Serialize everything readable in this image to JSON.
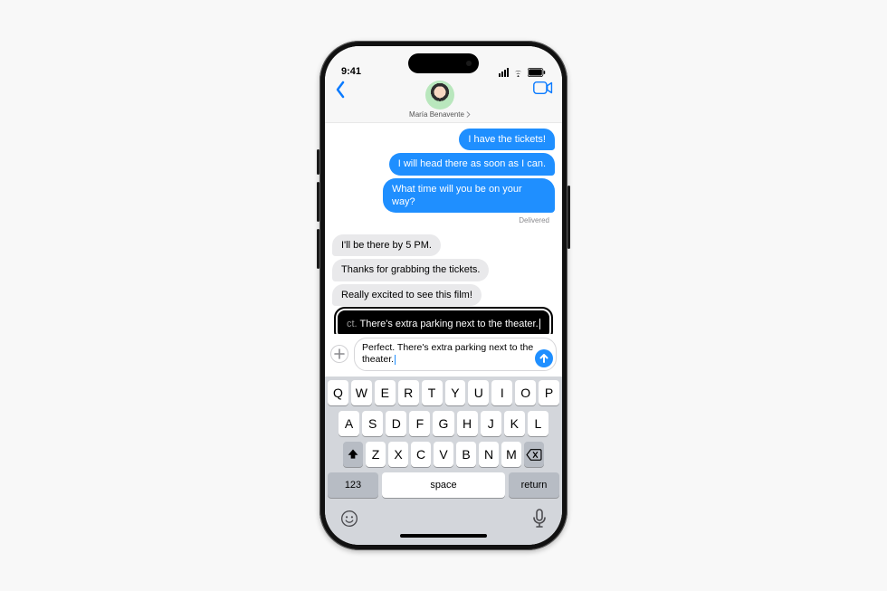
{
  "status": {
    "time": "9:41"
  },
  "contact": {
    "name": "María Benavente"
  },
  "messages": {
    "sent": [
      "I have the tickets!",
      "I will head there as soon as I can.",
      "What time will you be on your way?"
    ],
    "delivered_label": "Delivered",
    "received": [
      "I'll be there by 5 PM.",
      "Thanks for grabbing the tickets.",
      "Really excited to see this film!"
    ]
  },
  "suggestion": {
    "truncated_prefix": "ct. ",
    "visible": "There's extra parking next to the theater."
  },
  "input": {
    "text": "Perfect. There's extra parking next to the theater."
  },
  "keyboard": {
    "row1": [
      "Q",
      "W",
      "E",
      "R",
      "T",
      "Y",
      "U",
      "I",
      "O",
      "P"
    ],
    "row2": [
      "A",
      "S",
      "D",
      "F",
      "G",
      "H",
      "J",
      "K",
      "L"
    ],
    "row3": [
      "Z",
      "X",
      "C",
      "V",
      "B",
      "N",
      "M"
    ],
    "numbers_label": "123",
    "space_label": "space",
    "return_label": "return"
  }
}
